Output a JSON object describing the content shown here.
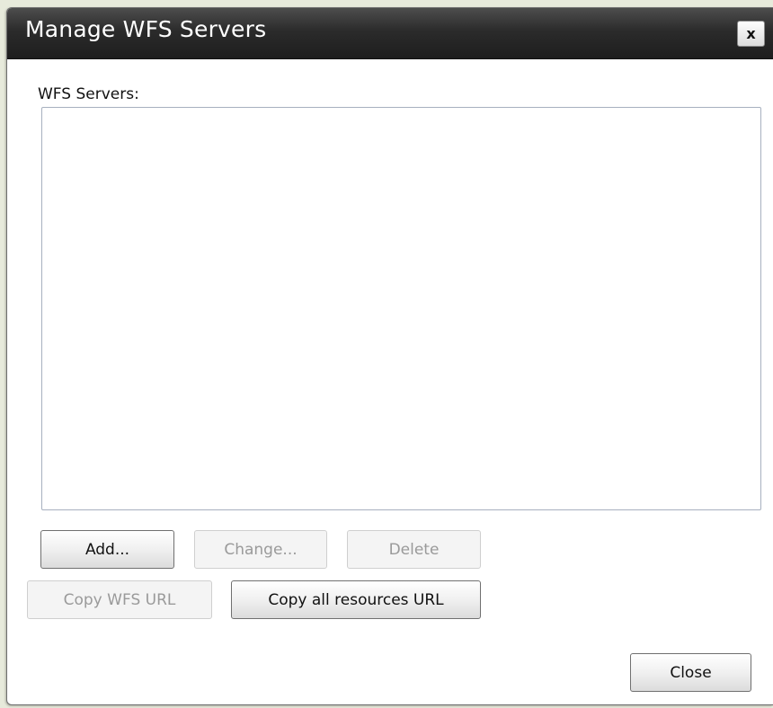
{
  "dialog": {
    "title": "Manage WFS Servers",
    "close_icon_label": "x",
    "servers_label": "WFS Servers:",
    "servers": []
  },
  "buttons": {
    "add": "Add...",
    "change": "Change...",
    "delete": "Delete",
    "copy_wfs_url": "Copy WFS URL",
    "copy_all_resources_url": "Copy all resources URL",
    "close": "Close"
  },
  "state": {
    "add_enabled": true,
    "change_enabled": false,
    "delete_enabled": false,
    "copy_wfs_url_enabled": false,
    "copy_all_resources_url_enabled": true,
    "close_enabled": true
  },
  "icons": {
    "close": "close-icon"
  }
}
